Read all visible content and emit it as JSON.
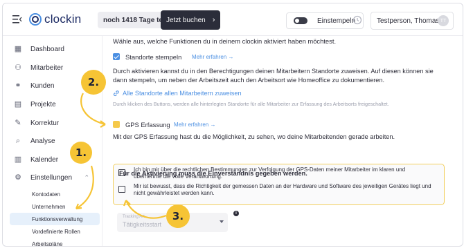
{
  "header": {
    "logo_text": "clockin",
    "trial_text": "noch 1418 Tage testen",
    "book_label": "Jetzt buchen",
    "clockin_label": "Einstempeln",
    "user_name": "Testperson, Thomas",
    "avatar_initials": "TT"
  },
  "sidebar": {
    "items": [
      {
        "label": "Dashboard",
        "icon": "dashboard-icon"
      },
      {
        "label": "Mitarbeiter",
        "icon": "people-icon"
      },
      {
        "label": "Kunden",
        "icon": "handshake-icon"
      },
      {
        "label": "Projekte",
        "icon": "clipboard-icon"
      },
      {
        "label": "Korrektur",
        "icon": "edit-icon"
      },
      {
        "label": "Analyse",
        "icon": "search-icon"
      },
      {
        "label": "Kalender",
        "icon": "calendar-icon"
      },
      {
        "label": "Einstellungen",
        "icon": "gear-icon"
      }
    ],
    "sub_items": [
      "Kontodaten",
      "Unternehmen",
      "Funktionsverwaltung",
      "Vordefinierte Rollen",
      "Arbeitspläne"
    ],
    "active_sub": "Funktionsverwaltung"
  },
  "main": {
    "intro": "Wähle aus, welche Funktionen du in deinem clockin aktiviert haben möchtest.",
    "standorte_label": "Standorte stempeln",
    "standorte_link": "Mehr erfahren →",
    "standorte_desc_1": "Durch aktivieren kannst du in den Berechtigungen deinen Mitarbeitern Standorte zuweisen. Auf diesen können sie",
    "standorte_desc_2": "dann stempeln, um neben der Arbeitszeit auch den Arbeitsort wie Homeoffice zu dokumentieren.",
    "assign_link": "Alle Standorte allen Mitarbeitern zuweisen",
    "assign_hint": "Durch klicken des Buttons, werden alle hinterlegten Standorte für alle Mitarbeiter zur Erfassung des Arbeitsorts freigeschaltet.",
    "gps_label": "GPS Erfassung",
    "gps_link": "Mehr erfahren →",
    "gps_desc": "Mit der GPS Erfassung hast du die Möglichkeit, zu sehen, wo deine Mitarbeitenden gerade arbeiten.",
    "consent_title": "Für die Aktivierung muss die Einverständnis gegeben werden.",
    "consent_1": "Ich bin mir über die rechtlichen Bestimmungen zur Verfolgung der GPS-Daten meiner Mitarbeiter im klaren und übernehme die volle Verantwortung.",
    "consent_2": "Mir ist bewusst, dass die Richtigkeit der gemessen Daten an der Hardware und Software des jeweiligen Gerätes liegt und nicht gewährleistet werden kann.",
    "tracking_label": "Tracking Art",
    "tracking_value": "Tätigkeitsstart"
  },
  "callouts": [
    "1.",
    "2.",
    "3."
  ],
  "colors": {
    "accent": "#4b8fe2",
    "highlight": "#f6c435",
    "dark": "#2b2d3a"
  }
}
